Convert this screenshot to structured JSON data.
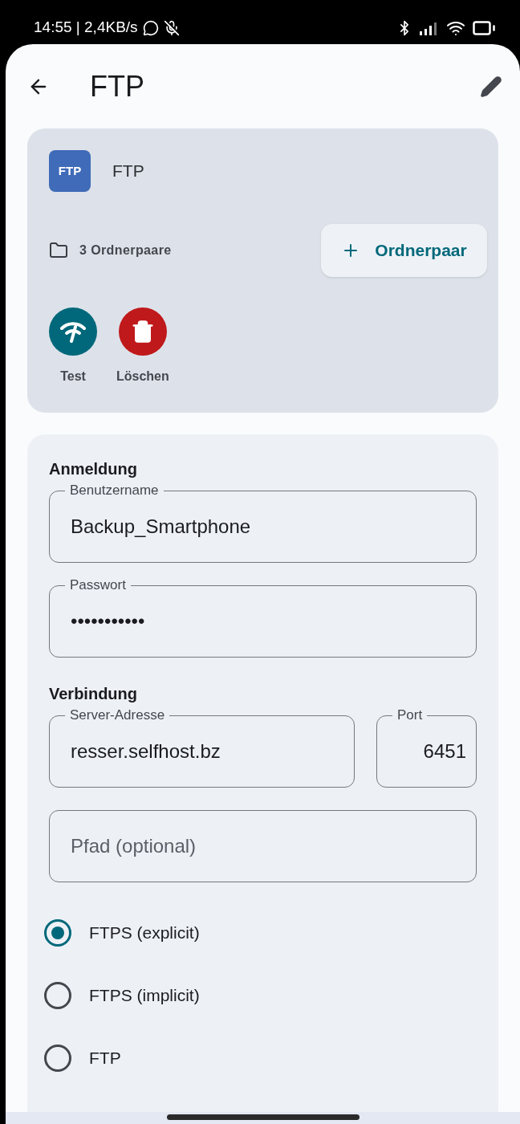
{
  "status_bar": {
    "time": "14:55 | 2,4KB/s"
  },
  "header": {
    "title": "FTP"
  },
  "account": {
    "badge": "FTP",
    "name": "FTP",
    "folder_pairs": "3 Ordnerpaare",
    "add_button": "Ordnerpaar",
    "actions": [
      {
        "kind": "test",
        "label": "Test"
      },
      {
        "kind": "delete",
        "label": "Löschen"
      }
    ]
  },
  "login": {
    "heading": "Anmeldung",
    "fields": [
      {
        "label": "Benutzername",
        "value": "Backup_Smartphone"
      },
      {
        "label": "Passwort",
        "value": "•••••••••••"
      }
    ]
  },
  "connection": {
    "heading": "Verbindung",
    "server": {
      "label": "Server-Adresse",
      "value": "resser.selfhost.bz"
    },
    "port": {
      "label": "Port",
      "value": "6451"
    },
    "path": {
      "placeholder": "Pfad (optional)"
    },
    "protocols": [
      {
        "label": "FTPS (explicit)",
        "selected": true
      },
      {
        "label": "FTPS (implicit)",
        "selected": false
      },
      {
        "label": "FTP",
        "selected": false
      }
    ]
  }
}
